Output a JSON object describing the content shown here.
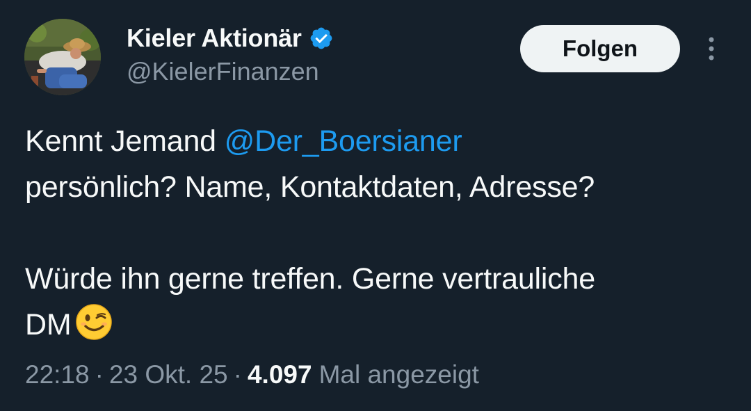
{
  "author": {
    "display_name": "Kieler Aktionär",
    "handle": "@KielerFinanzen",
    "verified": true,
    "verified_color": "#1d9bf0"
  },
  "actions": {
    "follow_label": "Folgen",
    "more_icon": "more-vertical-icon"
  },
  "tweet": {
    "line1_prefix": "Kennt Jemand ",
    "mention": "@Der_Boersianer",
    "line2": "persönlich? Name, Kontaktdaten, Adresse?",
    "line3": "Würde ihn gerne treffen. Gerne vertrauliche",
    "line4": "DM",
    "emoji": "winking-face-emoji"
  },
  "meta": {
    "time": "22:18",
    "date": "23 Okt. 25",
    "views_count": "4.097",
    "views_label": "Mal angezeigt",
    "separator": "·"
  },
  "colors": {
    "background": "#15202b",
    "text": "#f7f9f9",
    "secondary": "#8b98a5",
    "link": "#1d9bf0"
  }
}
